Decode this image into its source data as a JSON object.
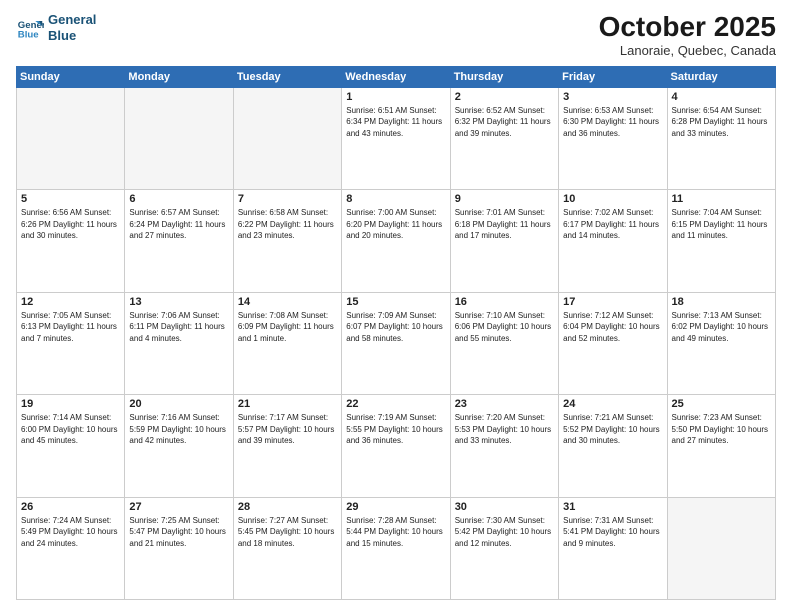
{
  "header": {
    "logo_line1": "General",
    "logo_line2": "Blue",
    "month": "October 2025",
    "location": "Lanoraie, Quebec, Canada"
  },
  "weekdays": [
    "Sunday",
    "Monday",
    "Tuesday",
    "Wednesday",
    "Thursday",
    "Friday",
    "Saturday"
  ],
  "weeks": [
    [
      {
        "day": "",
        "info": ""
      },
      {
        "day": "",
        "info": ""
      },
      {
        "day": "",
        "info": ""
      },
      {
        "day": "1",
        "info": "Sunrise: 6:51 AM\nSunset: 6:34 PM\nDaylight: 11 hours\nand 43 minutes."
      },
      {
        "day": "2",
        "info": "Sunrise: 6:52 AM\nSunset: 6:32 PM\nDaylight: 11 hours\nand 39 minutes."
      },
      {
        "day": "3",
        "info": "Sunrise: 6:53 AM\nSunset: 6:30 PM\nDaylight: 11 hours\nand 36 minutes."
      },
      {
        "day": "4",
        "info": "Sunrise: 6:54 AM\nSunset: 6:28 PM\nDaylight: 11 hours\nand 33 minutes."
      }
    ],
    [
      {
        "day": "5",
        "info": "Sunrise: 6:56 AM\nSunset: 6:26 PM\nDaylight: 11 hours\nand 30 minutes."
      },
      {
        "day": "6",
        "info": "Sunrise: 6:57 AM\nSunset: 6:24 PM\nDaylight: 11 hours\nand 27 minutes."
      },
      {
        "day": "7",
        "info": "Sunrise: 6:58 AM\nSunset: 6:22 PM\nDaylight: 11 hours\nand 23 minutes."
      },
      {
        "day": "8",
        "info": "Sunrise: 7:00 AM\nSunset: 6:20 PM\nDaylight: 11 hours\nand 20 minutes."
      },
      {
        "day": "9",
        "info": "Sunrise: 7:01 AM\nSunset: 6:18 PM\nDaylight: 11 hours\nand 17 minutes."
      },
      {
        "day": "10",
        "info": "Sunrise: 7:02 AM\nSunset: 6:17 PM\nDaylight: 11 hours\nand 14 minutes."
      },
      {
        "day": "11",
        "info": "Sunrise: 7:04 AM\nSunset: 6:15 PM\nDaylight: 11 hours\nand 11 minutes."
      }
    ],
    [
      {
        "day": "12",
        "info": "Sunrise: 7:05 AM\nSunset: 6:13 PM\nDaylight: 11 hours\nand 7 minutes."
      },
      {
        "day": "13",
        "info": "Sunrise: 7:06 AM\nSunset: 6:11 PM\nDaylight: 11 hours\nand 4 minutes."
      },
      {
        "day": "14",
        "info": "Sunrise: 7:08 AM\nSunset: 6:09 PM\nDaylight: 11 hours\nand 1 minute."
      },
      {
        "day": "15",
        "info": "Sunrise: 7:09 AM\nSunset: 6:07 PM\nDaylight: 10 hours\nand 58 minutes."
      },
      {
        "day": "16",
        "info": "Sunrise: 7:10 AM\nSunset: 6:06 PM\nDaylight: 10 hours\nand 55 minutes."
      },
      {
        "day": "17",
        "info": "Sunrise: 7:12 AM\nSunset: 6:04 PM\nDaylight: 10 hours\nand 52 minutes."
      },
      {
        "day": "18",
        "info": "Sunrise: 7:13 AM\nSunset: 6:02 PM\nDaylight: 10 hours\nand 49 minutes."
      }
    ],
    [
      {
        "day": "19",
        "info": "Sunrise: 7:14 AM\nSunset: 6:00 PM\nDaylight: 10 hours\nand 45 minutes."
      },
      {
        "day": "20",
        "info": "Sunrise: 7:16 AM\nSunset: 5:59 PM\nDaylight: 10 hours\nand 42 minutes."
      },
      {
        "day": "21",
        "info": "Sunrise: 7:17 AM\nSunset: 5:57 PM\nDaylight: 10 hours\nand 39 minutes."
      },
      {
        "day": "22",
        "info": "Sunrise: 7:19 AM\nSunset: 5:55 PM\nDaylight: 10 hours\nand 36 minutes."
      },
      {
        "day": "23",
        "info": "Sunrise: 7:20 AM\nSunset: 5:53 PM\nDaylight: 10 hours\nand 33 minutes."
      },
      {
        "day": "24",
        "info": "Sunrise: 7:21 AM\nSunset: 5:52 PM\nDaylight: 10 hours\nand 30 minutes."
      },
      {
        "day": "25",
        "info": "Sunrise: 7:23 AM\nSunset: 5:50 PM\nDaylight: 10 hours\nand 27 minutes."
      }
    ],
    [
      {
        "day": "26",
        "info": "Sunrise: 7:24 AM\nSunset: 5:49 PM\nDaylight: 10 hours\nand 24 minutes."
      },
      {
        "day": "27",
        "info": "Sunrise: 7:25 AM\nSunset: 5:47 PM\nDaylight: 10 hours\nand 21 minutes."
      },
      {
        "day": "28",
        "info": "Sunrise: 7:27 AM\nSunset: 5:45 PM\nDaylight: 10 hours\nand 18 minutes."
      },
      {
        "day": "29",
        "info": "Sunrise: 7:28 AM\nSunset: 5:44 PM\nDaylight: 10 hours\nand 15 minutes."
      },
      {
        "day": "30",
        "info": "Sunrise: 7:30 AM\nSunset: 5:42 PM\nDaylight: 10 hours\nand 12 minutes."
      },
      {
        "day": "31",
        "info": "Sunrise: 7:31 AM\nSunset: 5:41 PM\nDaylight: 10 hours\nand 9 minutes."
      },
      {
        "day": "",
        "info": ""
      }
    ]
  ]
}
